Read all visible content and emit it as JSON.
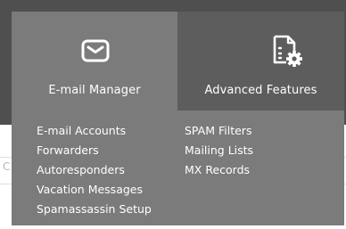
{
  "background": {
    "partial_char": "C"
  },
  "tabs": [
    {
      "label": "E-mail Manager",
      "icon": "envelope-icon"
    },
    {
      "label": "Advanced Features",
      "icon": "document-settings-icon"
    }
  ],
  "menu": {
    "left_column": [
      "E-mail Accounts",
      "Forwarders",
      "Autoresponders",
      "Vacation Messages",
      "Spamassassin Setup"
    ],
    "right_column": [
      "SPAM Filters",
      "Mailing Lists",
      "MX Records"
    ]
  },
  "colors": {
    "panel": "#7b7b7b",
    "inactive_tab": "#5d5d5d",
    "header_band": "#4f4f4f",
    "text": "#ffffff"
  }
}
